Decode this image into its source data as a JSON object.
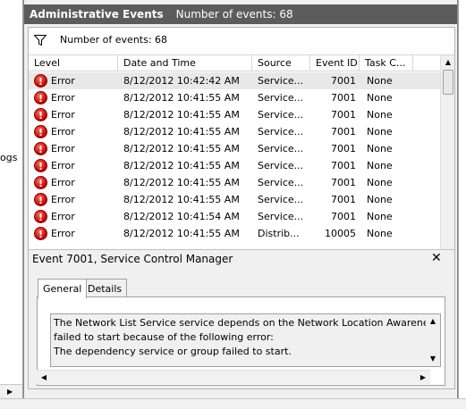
{
  "left_pane": {
    "partial_label": "ogs"
  },
  "title_bar": {
    "title": "Administrative Events",
    "count": "Number of events: 68"
  },
  "filter": {
    "text": "Number of events: 68"
  },
  "columns": [
    "Level",
    "Date and Time",
    "Source",
    "Event ID",
    "Task C..."
  ],
  "events": [
    {
      "level": "Error",
      "datetime": "8/12/2012 10:42:42 AM",
      "source": "Service...",
      "event_id": "7001",
      "task": "None"
    },
    {
      "level": "Error",
      "datetime": "8/12/2012 10:41:55 AM",
      "source": "Service...",
      "event_id": "7001",
      "task": "None"
    },
    {
      "level": "Error",
      "datetime": "8/12/2012 10:41:55 AM",
      "source": "Service...",
      "event_id": "7001",
      "task": "None"
    },
    {
      "level": "Error",
      "datetime": "8/12/2012 10:41:55 AM",
      "source": "Service...",
      "event_id": "7001",
      "task": "None"
    },
    {
      "level": "Error",
      "datetime": "8/12/2012 10:41:55 AM",
      "source": "Service...",
      "event_id": "7001",
      "task": "None"
    },
    {
      "level": "Error",
      "datetime": "8/12/2012 10:41:55 AM",
      "source": "Service...",
      "event_id": "7001",
      "task": "None"
    },
    {
      "level": "Error",
      "datetime": "8/12/2012 10:41:55 AM",
      "source": "Service...",
      "event_id": "7001",
      "task": "None"
    },
    {
      "level": "Error",
      "datetime": "8/12/2012 10:41:55 AM",
      "source": "Service...",
      "event_id": "7001",
      "task": "None"
    },
    {
      "level": "Error",
      "datetime": "8/12/2012 10:41:54 AM",
      "source": "Service...",
      "event_id": "7001",
      "task": "None"
    },
    {
      "level": "Error",
      "datetime": "8/12/2012 10:41:55 AM",
      "source": "Distrib...",
      "event_id": "10005",
      "task": "None"
    }
  ],
  "detail": {
    "title": "Event 7001, Service Control Manager",
    "close_glyph": "✕",
    "tabs": [
      "General",
      "Details"
    ],
    "message_lines": [
      "The Network List Service service depends on the Network Location Awareness s",
      "failed to start because of the following error:",
      "The dependency service or group failed to start."
    ]
  },
  "icons": {
    "level_icon": "error-icon",
    "filter_icon": "filter-icon"
  },
  "colors": {
    "title_bar_bg": "#5c5c5c",
    "error_red": "#c00000"
  }
}
